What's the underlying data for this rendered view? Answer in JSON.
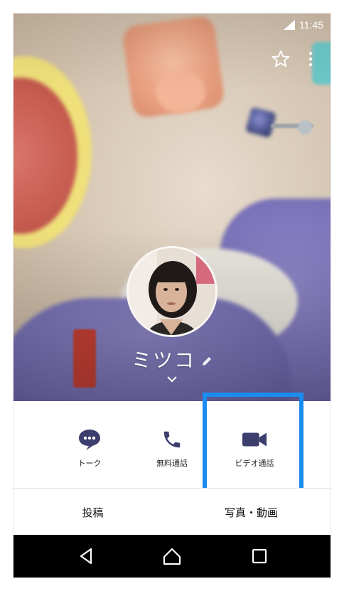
{
  "status_bar": {
    "time": "11:45"
  },
  "profile": {
    "name": "ミツコ"
  },
  "actions": [
    {
      "label": "トーク",
      "icon": "chat-bubble-icon"
    },
    {
      "label": "無料通話",
      "icon": "phone-icon"
    },
    {
      "label": "ビデオ通話",
      "icon": "video-camera-icon"
    }
  ],
  "tabs": [
    {
      "label": "投稿"
    },
    {
      "label": "写真・動画"
    }
  ],
  "colors": {
    "icon_color": "#3c3f6e",
    "highlight": "#1a8cf0",
    "nav_bar": "#000000"
  }
}
